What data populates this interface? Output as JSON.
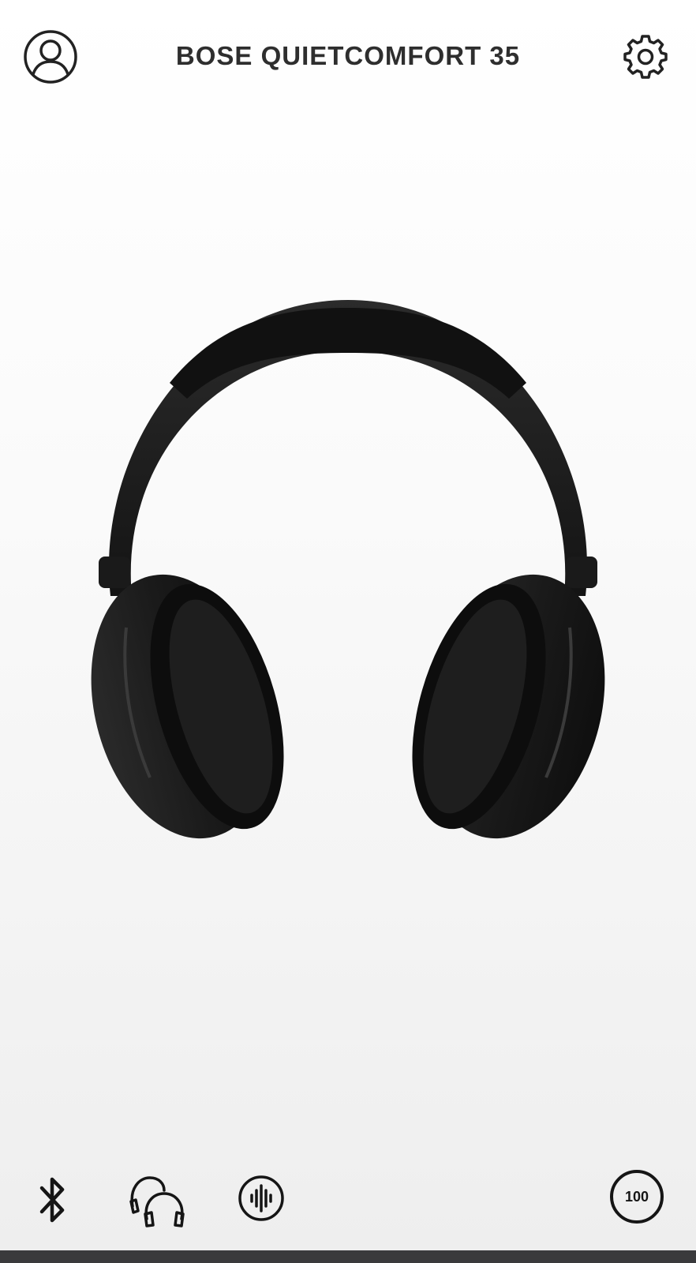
{
  "header": {
    "title": "BOSE QUIETCOMFORT 35",
    "profile_icon": "user-profile-icon",
    "settings_icon": "gear-icon"
  },
  "hero": {
    "image": "headphones-product-image"
  },
  "bottom_bar": {
    "icons": [
      "bluetooth-icon",
      "headphones-share-icon",
      "audio-waveform-icon"
    ],
    "battery_level": "100"
  },
  "colors": {
    "background_top": "#ffffff",
    "background_bottom": "#eeeeee",
    "icon": "#1e1e1e",
    "headphone_body": "#1c1c1c"
  }
}
